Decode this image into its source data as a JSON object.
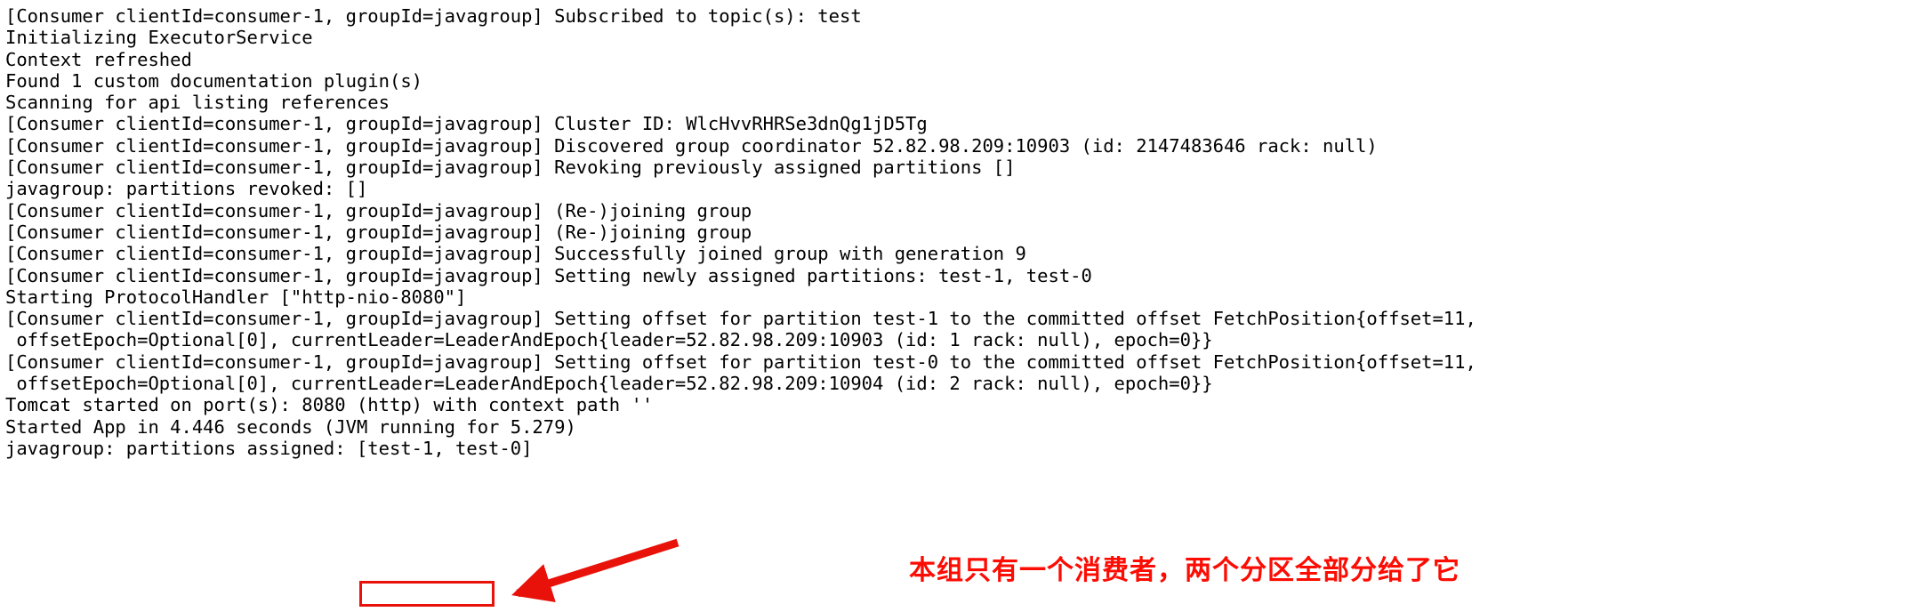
{
  "console": {
    "lines": [
      "[Consumer clientId=consumer-1, groupId=javagroup] Subscribed to topic(s): test",
      "Initializing ExecutorService",
      "Context refreshed",
      "Found 1 custom documentation plugin(s)",
      "Scanning for api listing references",
      "[Consumer clientId=consumer-1, groupId=javagroup] Cluster ID: WlcHvvRHRSe3dnQg1jD5Tg",
      "[Consumer clientId=consumer-1, groupId=javagroup] Discovered group coordinator 52.82.98.209:10903 (id: 2147483646 rack: null)",
      "[Consumer clientId=consumer-1, groupId=javagroup] Revoking previously assigned partitions []",
      "javagroup: partitions revoked: []",
      "[Consumer clientId=consumer-1, groupId=javagroup] (Re-)joining group",
      "[Consumer clientId=consumer-1, groupId=javagroup] (Re-)joining group",
      "[Consumer clientId=consumer-1, groupId=javagroup] Successfully joined group with generation 9",
      "[Consumer clientId=consumer-1, groupId=javagroup] Setting newly assigned partitions: test-1, test-0",
      "Starting ProtocolHandler [\"http-nio-8080\"]",
      "[Consumer clientId=consumer-1, groupId=javagroup] Setting offset for partition test-1 to the committed offset FetchPosition{offset=11,",
      " offsetEpoch=Optional[0], currentLeader=LeaderAndEpoch{leader=52.82.98.209:10903 (id: 1 rack: null), epoch=0}}",
      "[Consumer clientId=consumer-1, groupId=javagroup] Setting offset for partition test-0 to the committed offset FetchPosition{offset=11,",
      " offsetEpoch=Optional[0], currentLeader=LeaderAndEpoch{leader=52.82.98.209:10904 (id: 2 rack: null), epoch=0}}",
      "Tomcat started on port(s): 8080 (http) with context path ''",
      "Started App in 4.446 seconds (JVM running for 5.279)",
      "javagroup: partitions assigned: [test-1, test-0]"
    ]
  },
  "annotation": {
    "text": "本组只有一个消费者，两个分区全部分给了它",
    "color": "#fc0d04",
    "highlight_value": "[test-1, test-0]"
  }
}
